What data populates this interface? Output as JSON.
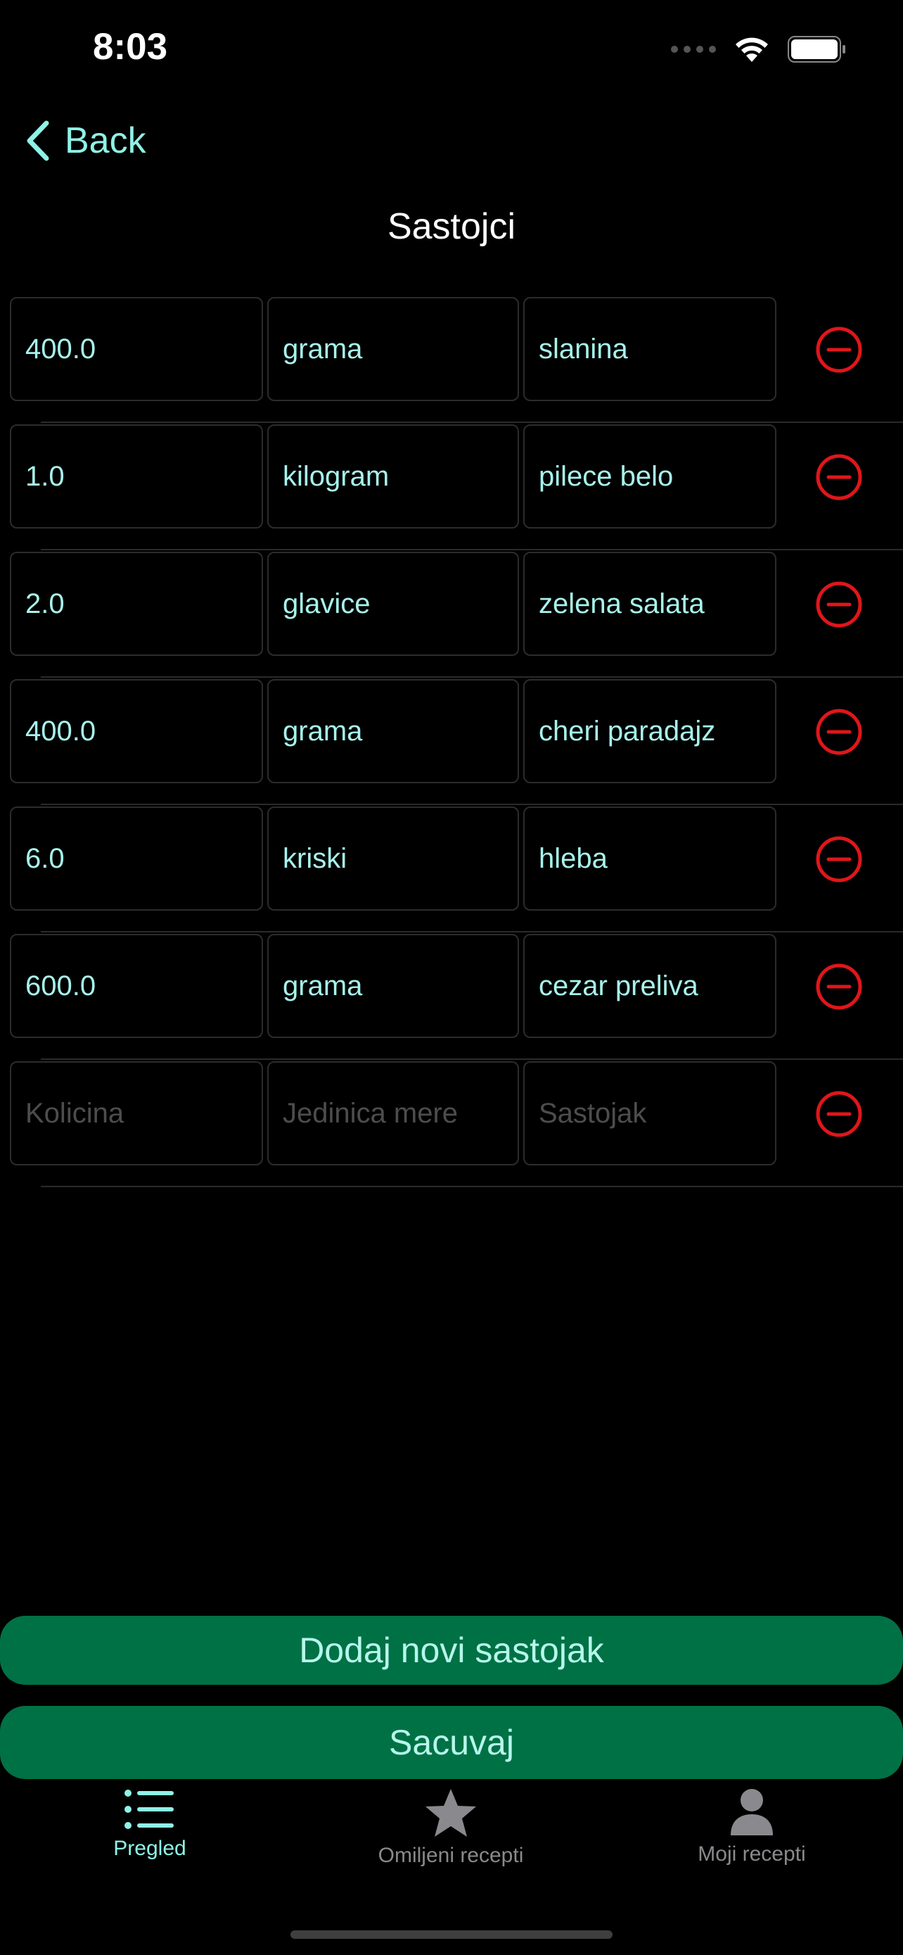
{
  "status": {
    "time": "8:03"
  },
  "nav": {
    "back_label": "Back",
    "title": "Sastojci"
  },
  "ingredients": [
    {
      "kolicina": "400.0",
      "jedinica": "grama",
      "sastojak": "slanina"
    },
    {
      "kolicina": "1.0",
      "jedinica": "kilogram",
      "sastojak": "pilece belo"
    },
    {
      "kolicina": "2.0",
      "jedinica": "glavice",
      "sastojak": "zelena salata"
    },
    {
      "kolicina": "400.0",
      "jedinica": "grama",
      "sastojak": "cheri paradajz"
    },
    {
      "kolicina": "6.0",
      "jedinica": "kriski",
      "sastojak": "hleba"
    },
    {
      "kolicina": "600.0",
      "jedinica": "grama",
      "sastojak": "cezar preliva"
    }
  ],
  "new_row": {
    "kolicina_placeholder": "Kolicina",
    "jedinica_placeholder": "Jedinica mere",
    "sastojak_placeholder": "Sastojak"
  },
  "buttons": {
    "add_label": "Dodaj novi sastojak",
    "save_label": "Sacuvaj"
  },
  "tabs": [
    {
      "label": "Pregled",
      "icon": "list-icon",
      "active": true
    },
    {
      "label": "Omiljeni recepti",
      "icon": "star-icon",
      "active": false
    },
    {
      "label": "Moji recepti",
      "icon": "person-icon",
      "active": false
    }
  ],
  "colors": {
    "accent": "#8ff2e6",
    "field_text": "#a7f3ec",
    "remove": "#e0161a",
    "button_bg": "#007145"
  }
}
